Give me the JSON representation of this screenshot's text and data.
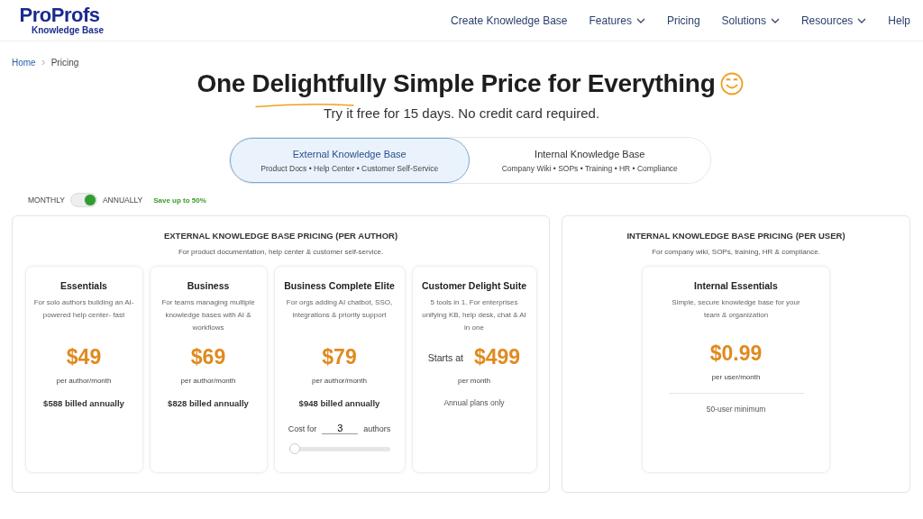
{
  "header": {
    "logo": {
      "brand": "ProProfs",
      "product": "Knowledge Base"
    },
    "nav": [
      {
        "label": "Create Knowledge Base",
        "dropdown": false
      },
      {
        "label": "Features",
        "dropdown": true
      },
      {
        "label": "Pricing",
        "dropdown": false
      },
      {
        "label": "Solutions",
        "dropdown": true
      },
      {
        "label": "Resources",
        "dropdown": true
      },
      {
        "label": "Help",
        "dropdown": false
      }
    ]
  },
  "breadcrumb": [
    "Home",
    "Pricing"
  ],
  "hero": {
    "title_parts": [
      "One",
      "Delightfully",
      "Simple Price for Everything"
    ],
    "subtitle": "Try it free for 15 days. No credit card required."
  },
  "tabs": [
    {
      "label": "External Knowledge Base",
      "sub": "Product Docs • Help Center • Customer Self-Service",
      "selected": true
    },
    {
      "label": "Internal Knowledge Base",
      "sub": "Company Wiki • SOPs • Training • HR • Compliance",
      "selected": false
    }
  ],
  "billing": {
    "monthly": "MONTHLY",
    "annually": "ANNUALLY",
    "on": true,
    "save": "Save up to 50%"
  },
  "panels": [
    {
      "title": "EXTERNAL KNOWLEDGE BASE PRICING (PER AUTHOR)",
      "subtitle": "For product documentation, help center & customer self-service.",
      "plans": [
        {
          "kind": "standard",
          "name": "Essentials",
          "desc": "For solo authors building an AI-powered help center- fast",
          "price": "$49",
          "unit": "per author/month",
          "note": "$588 billed annually"
        },
        {
          "kind": "standard",
          "name": "Business",
          "desc": "For teams managing multiple knowledge bases with AI & workflows",
          "price": "$69",
          "unit": "per author/month",
          "note": "$828 billed annually"
        },
        {
          "kind": "calculator",
          "name": "Business Complete Elite",
          "desc": "For orgs adding AI chatbot, SSO, integrations & priority support",
          "price": "$79",
          "unit": "per author/month",
          "note": "$948 billed annually",
          "cost_label": "Cost for",
          "seats": "3",
          "seats_unit": "authors",
          "level": 0
        },
        {
          "kind": "suite",
          "name": "Customer Delight Suite",
          "desc": "5 tools in 1. For enterprises unifying KB, help desk, chat & AI in one",
          "prefix": "Starts at",
          "price": "$499",
          "unit": "per month",
          "note": "Annual plans only"
        }
      ]
    },
    {
      "title": "INTERNAL KNOWLEDGE BASE PRICING (PER USER)",
      "subtitle": "For company wiki, SOPs, training, HR & compliance.",
      "plans": [
        {
          "kind": "internal",
          "name": "Internal Essentials",
          "desc": "Simple, secure knowledge base for your team & organization",
          "price": "$0.99",
          "unit": "per user/month",
          "note": "50-user minimum"
        }
      ]
    }
  ]
}
